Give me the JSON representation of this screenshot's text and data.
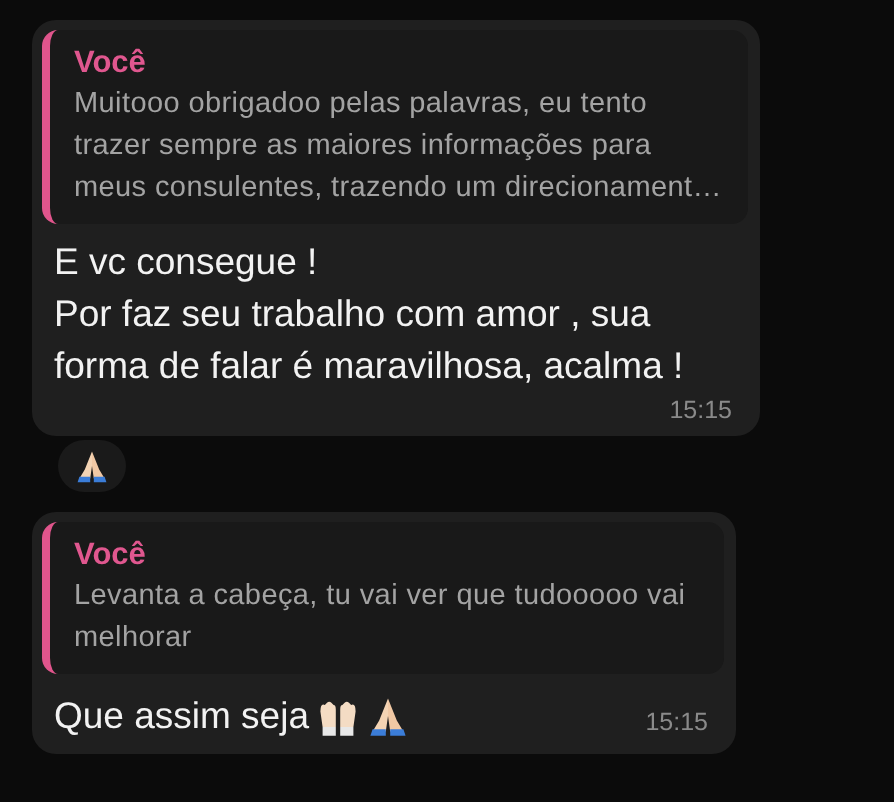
{
  "messages": [
    {
      "quote": {
        "author": "Você",
        "text": "Muitooo obrigadoo pelas palavras, eu tento trazer sempre as maiores informações para meus consulentes, trazendo um direcionament…"
      },
      "lines": [
        "E vc consegue !",
        "Por faz seu trabalho com amor , sua",
        "forma de falar é maravilhosa, acalma !"
      ],
      "time": "15:15",
      "reaction": {
        "kind": "praying-hands"
      }
    },
    {
      "quote": {
        "author": "Você",
        "text": "Levanta a cabeça, tu vai ver que tudooooo vai melhorar"
      },
      "lines": [
        "Que assim seja"
      ],
      "emojis": [
        {
          "kind": "raised-hands"
        },
        {
          "kind": "praying-hands"
        }
      ],
      "time": "15:15"
    }
  ]
}
